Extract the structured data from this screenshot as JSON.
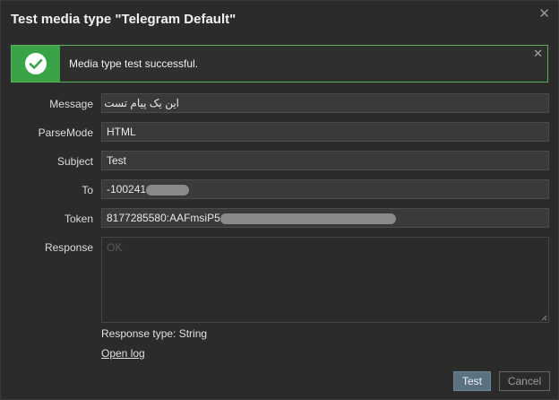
{
  "dialog": {
    "title": "Test media type \"Telegram Default\"",
    "close_glyph": "✕"
  },
  "alert": {
    "text": "Media type test successful.",
    "icon": "check-circle-icon",
    "close_glyph": "✕",
    "color": "#3aa348"
  },
  "form": {
    "message_label": "Message",
    "message_value": "این یک پیام تست است.",
    "parsemode_label": "ParseMode",
    "parsemode_value": "HTML",
    "subject_label": "Subject",
    "subject_value": "Test",
    "to_label": "To",
    "to_value": "-100241",
    "token_label": "Token",
    "token_value": "8177285580:AAFmsiP5",
    "response_label": "Response",
    "response_value": "OK",
    "response_type": "Response type: String",
    "open_log": "Open log"
  },
  "buttons": {
    "test": "Test",
    "cancel": "Cancel"
  }
}
